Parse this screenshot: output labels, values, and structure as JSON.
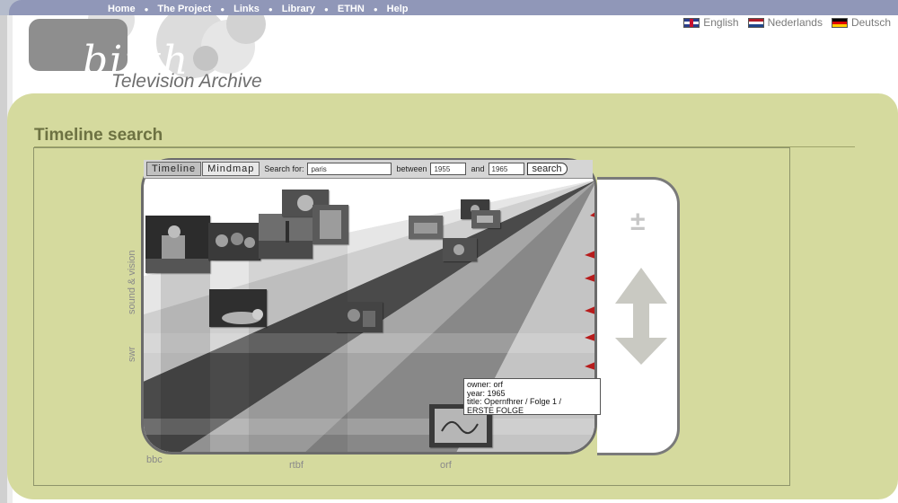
{
  "nav": {
    "items": [
      "Home",
      "The Project",
      "Links",
      "Library",
      "ETHN",
      "Help"
    ]
  },
  "languages": [
    {
      "label": "English",
      "flag": "uk-flag-icon"
    },
    {
      "label": "Nederlands",
      "flag": "nl-flag-icon"
    },
    {
      "label": "Deutsch",
      "flag": "de-flag-icon"
    }
  ],
  "logo": {
    "word": "birth",
    "subtitle": "Television Archive"
  },
  "page": {
    "title": "Timeline search"
  },
  "toolbar": {
    "tab_timeline": "Timeline",
    "tab_mindmap": "Mindmap",
    "search_for_label": "Search for:",
    "search_value": "paris",
    "between_label": "between",
    "from_year": "1955",
    "and_label": "and",
    "to_year": "1965",
    "search_button": "search"
  },
  "timeline": {
    "left_axis_labels": [
      "sound & vision",
      "swr"
    ],
    "bottom_axis_labels": [
      "bbc",
      "rtbf",
      "orf"
    ],
    "zoom_symbol": "±"
  },
  "tooltip": {
    "owner": "owner: orf",
    "year": "year: 1965",
    "title_line1": "title: Opernfhrer / Folge 1 /",
    "title_line2": "ERSTE FOLGE"
  },
  "colors": {
    "nav_bar": "#9097b8",
    "panel_bg": "#d5da9e",
    "title_color": "#6d7242"
  }
}
